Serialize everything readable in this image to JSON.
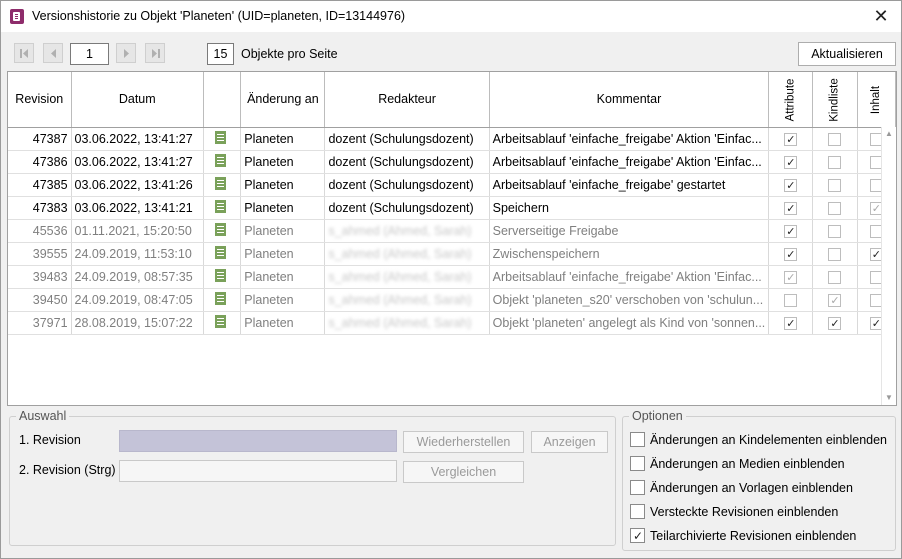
{
  "window": {
    "title": "Versionshistorie zu Objekt 'Planeten' (UID=planeten, ID=13144976)"
  },
  "pager": {
    "page": "1",
    "per_page": "15",
    "per_page_label": "Objekte pro Seite",
    "refresh_label": "Aktualisieren"
  },
  "table": {
    "columns": [
      "Revision",
      "Datum",
      "",
      "Änderung an",
      "Redakteur",
      "Kommentar",
      "Attribute",
      "Kindliste",
      "Inhalt"
    ],
    "rows": [
      {
        "rev": "47387",
        "date": "03.06.2022, 13:41:27",
        "obj": "Planeten",
        "editor": "dozent (Schulungsdozent)",
        "comment": "Arbeitsablauf 'einfache_freigabe' Aktion 'Einfac...",
        "attr": true,
        "kind": false,
        "inhalt": false,
        "muted": false
      },
      {
        "rev": "47386",
        "date": "03.06.2022, 13:41:27",
        "obj": "Planeten",
        "editor": "dozent (Schulungsdozent)",
        "comment": "Arbeitsablauf 'einfache_freigabe' Aktion 'Einfac...",
        "attr": true,
        "kind": false,
        "inhalt": false,
        "muted": false
      },
      {
        "rev": "47385",
        "date": "03.06.2022, 13:41:26",
        "obj": "Planeten",
        "editor": "dozent (Schulungsdozent)",
        "comment": "Arbeitsablauf 'einfache_freigabe' gestartet",
        "attr": true,
        "kind": false,
        "inhalt": false,
        "muted": false
      },
      {
        "rev": "47383",
        "date": "03.06.2022, 13:41:21",
        "obj": "Planeten",
        "editor": "dozent (Schulungsdozent)",
        "comment": "Speichern",
        "attr": true,
        "kind": false,
        "inhalt": true,
        "inhalt_light": true,
        "muted": false
      },
      {
        "rev": "45536",
        "date": "01.11.2021, 15:20:50",
        "obj": "Planeten",
        "editor": "s_ahmed (Ahmed, Sarah)",
        "comment": "Serverseitige Freigabe",
        "attr": true,
        "kind": false,
        "inhalt": false,
        "muted": true
      },
      {
        "rev": "39555",
        "date": "24.09.2019, 11:53:10",
        "obj": "Planeten",
        "editor": "s_ahmed (Ahmed, Sarah)",
        "comment": "Zwischenspeichern",
        "attr": true,
        "kind": false,
        "inhalt": true,
        "muted": true
      },
      {
        "rev": "39483",
        "date": "24.09.2019, 08:57:35",
        "obj": "Planeten",
        "editor": "s_ahmed (Ahmed, Sarah)",
        "comment": "Arbeitsablauf 'einfache_freigabe' Aktion 'Einfac...",
        "attr": true,
        "attr_light": true,
        "kind": false,
        "inhalt": false,
        "muted": true
      },
      {
        "rev": "39450",
        "date": "24.09.2019, 08:47:05",
        "obj": "Planeten",
        "editor": "s_ahmed (Ahmed, Sarah)",
        "comment": "Objekt 'planeten_s20' verschoben von 'schulun...",
        "attr": false,
        "kind": true,
        "kind_light": true,
        "inhalt": false,
        "muted": true
      },
      {
        "rev": "37971",
        "date": "28.08.2019, 15:07:22",
        "obj": "Planeten",
        "editor": "s_ahmed (Ahmed, Sarah)",
        "comment": "Objekt 'planeten' angelegt als Kind von 'sonnen...",
        "attr": true,
        "kind": true,
        "inhalt": true,
        "muted": true
      }
    ]
  },
  "auswahl": {
    "legend": "Auswahl",
    "rev1_label": "1. Revision",
    "rev2_label": "2. Revision (Strg)",
    "restore_label": "Wiederherstellen",
    "show_label": "Anzeigen",
    "compare_label": "Vergleichen"
  },
  "optionen": {
    "legend": "Optionen",
    "items": [
      {
        "label": "Änderungen an Kindelementen einblenden",
        "checked": false
      },
      {
        "label": "Änderungen an Medien einblenden",
        "checked": false
      },
      {
        "label": "Änderungen an Vorlagen einblenden",
        "checked": false
      },
      {
        "label": "Versteckte Revisionen einblenden",
        "checked": false
      },
      {
        "label": "Teilarchivierte Revisionen einblenden",
        "checked": true
      }
    ]
  },
  "colors": {
    "accent": "#8e2c6b",
    "doc_icon": "#7aa15a",
    "muted_text": "#7f7f7f"
  }
}
